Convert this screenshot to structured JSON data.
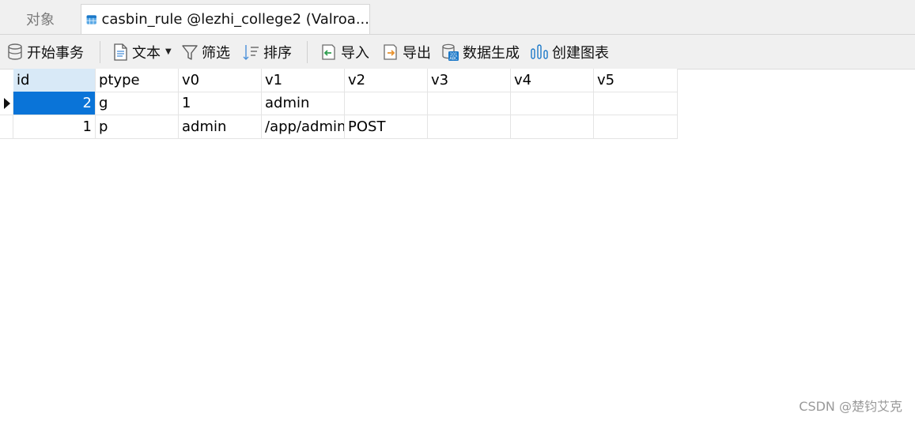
{
  "tabs": {
    "objects_label": "对象",
    "active_title": "casbin_rule @lezhi_college2 (Valroa..."
  },
  "toolbar": {
    "begin_transaction": "开始事务",
    "text": "文本",
    "filter": "筛选",
    "sort": "排序",
    "import": "导入",
    "export": "导出",
    "data_generation": "数据生成",
    "create_chart": "创建图表"
  },
  "grid": {
    "columns": [
      "id",
      "ptype",
      "v0",
      "v1",
      "v2",
      "v3",
      "v4",
      "v5"
    ],
    "rows": [
      [
        "2",
        "g",
        "1",
        "admin",
        "",
        "",
        "",
        ""
      ],
      [
        "1",
        "p",
        "admin",
        "/app/admin",
        "POST",
        "",
        "",
        ""
      ]
    ]
  },
  "watermark": "CSDN @楚钧艾克"
}
